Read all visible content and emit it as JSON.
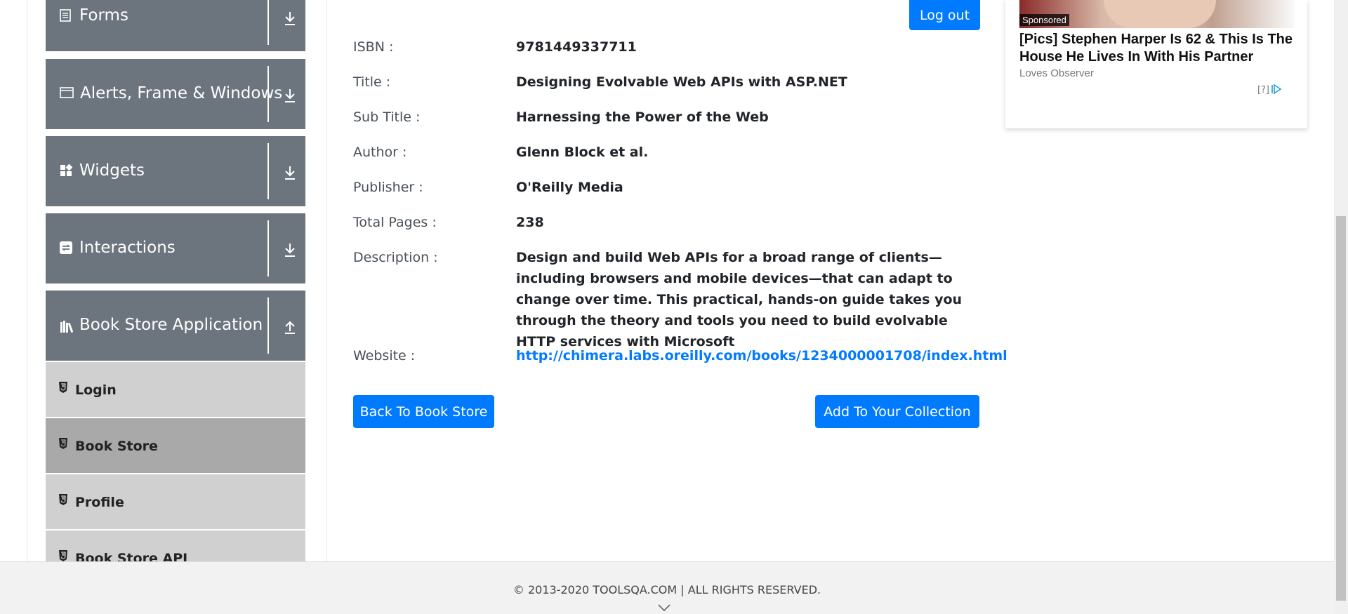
{
  "sidebar": {
    "groups": [
      {
        "label": "Forms",
        "icon": "form-icon",
        "toggle": "download-icon"
      },
      {
        "label": "Alerts, Frame & Windows",
        "icon": "window-icon",
        "toggle": "download-icon"
      },
      {
        "label": "Widgets",
        "icon": "widgets-icon",
        "toggle": "download-icon"
      },
      {
        "label": "Interactions",
        "icon": "interactions-icon",
        "toggle": "download-icon"
      },
      {
        "label": "Book Store Application",
        "icon": "books-icon",
        "toggle": "upload-icon"
      }
    ],
    "items": [
      {
        "label": "Login",
        "icon": "html5-icon"
      },
      {
        "label": "Book Store",
        "icon": "html5-icon",
        "active": true
      },
      {
        "label": "Profile",
        "icon": "html5-icon"
      },
      {
        "label": "Book Store API",
        "icon": "html5-icon"
      }
    ]
  },
  "header": {
    "logout_label": "Log out"
  },
  "book": {
    "isbn_label": "ISBN :",
    "isbn": "9781449337711",
    "title_label": "Title :",
    "title": "Designing Evolvable Web APIs with ASP.NET",
    "subtitle_label": "Sub Title :",
    "subtitle": "Harnessing the Power of the Web",
    "author_label": "Author :",
    "author": "Glenn Block et al.",
    "publisher_label": "Publisher :",
    "publisher": "O'Reilly Media",
    "pages_label": "Total Pages :",
    "pages": "238",
    "description_label": "Description :",
    "description": "Design and build Web APIs for a broad range of clients—including browsers and mobile devices—that can adapt to change over time. This practical, hands-on guide takes you through the theory and tools you need to build evolvable HTTP services with Microsoft",
    "website_label": "Website :",
    "website": "http://chimera.labs.oreilly.com/books/1234000001708/index.html"
  },
  "actions": {
    "back_label": "Back To Book Store",
    "add_label": "Add To Your Collection"
  },
  "ad": {
    "sponsored": "Sponsored",
    "headline": "[Pics] Stephen Harper Is 62 & This Is The House He Lives In With His Partner",
    "source": "Loves Observer",
    "info": "[?]"
  },
  "footer": {
    "copyright": "© 2013-2020 TOOLSQA.COM | ALL RIGHTS RESERVED."
  },
  "colors": {
    "primary": "#007bff",
    "sidebar_group": "#6c757d",
    "sidebar_item": "#d0d0d0",
    "sidebar_item_active": "#a9a9a9"
  }
}
